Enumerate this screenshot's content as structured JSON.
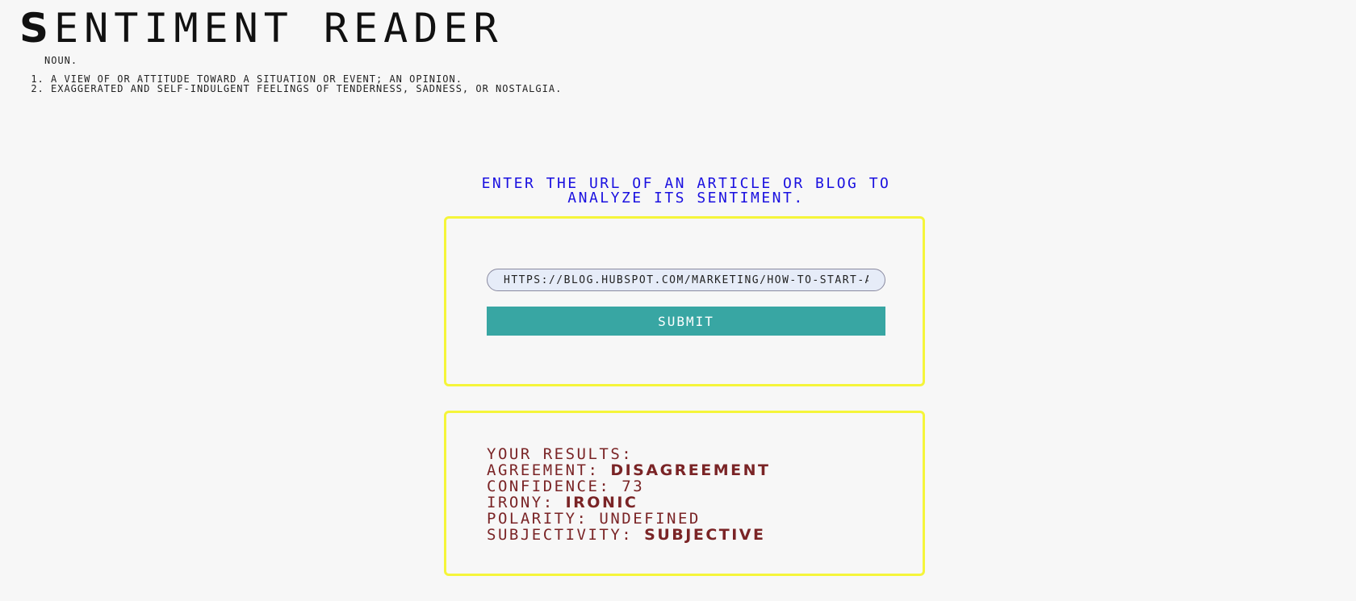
{
  "header": {
    "title_cap": "S",
    "title_rest": "ENTIMENT READER",
    "part_of_speech": "NOUN.",
    "definitions": [
      "A VIEW OF OR ATTITUDE TOWARD A SITUATION OR EVENT; AN OPINION.",
      "EXAGGERATED AND SELF-INDULGENT FEELINGS OF TENDERNESS, SADNESS, OR NOSTALGIA."
    ]
  },
  "prompt": {
    "text": "ENTER THE URL OF AN ARTICLE OR BLOG TO ANALYZE ITS SENTIMENT."
  },
  "form": {
    "url_value": "HTTPS://BLOG.HUBSPOT.COM/MARKETING/HOW-TO-START-A-BLOG",
    "submit_label": "SUBMIT"
  },
  "results": {
    "heading": "YOUR RESULTS:",
    "agreement_label": "AGREEMENT:",
    "agreement_value": "DISAGREEMENT",
    "confidence_label": "CONFIDENCE:",
    "confidence_value": "73",
    "irony_label": "IRONY:",
    "irony_value": "IRONIC",
    "polarity_label": "POLARITY:",
    "polarity_value": "UNDEFINED",
    "subjectivity_label": "SUBJECTIVITY:",
    "subjectivity_value": "SUBJECTIVE"
  },
  "colors": {
    "background": "#f7f7f7",
    "prompt_blue": "#1a10e0",
    "card_border_yellow": "#f5f53a",
    "submit_teal": "#38a6a3",
    "results_maroon": "#7a2426"
  }
}
